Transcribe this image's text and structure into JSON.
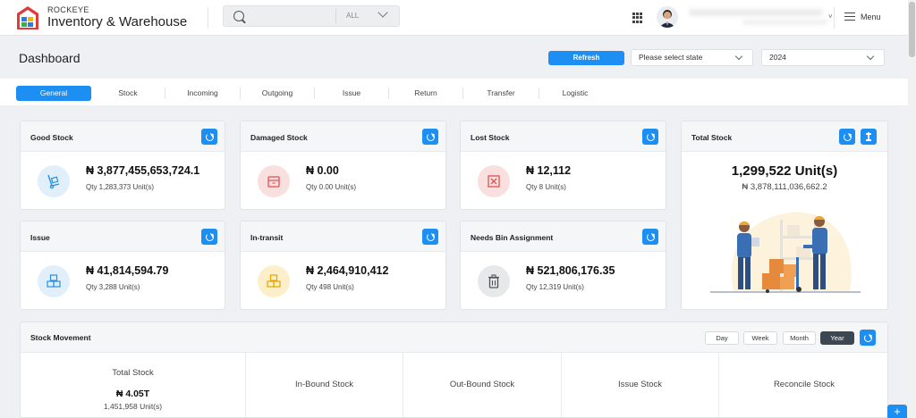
{
  "app": {
    "brand_small": "ROCKEYE",
    "brand_big": "Inventory & Warehouse",
    "menu_label": "Menu"
  },
  "search": {
    "placeholder": "",
    "scope": "ALL"
  },
  "dashboard": {
    "title": "Dashboard",
    "refresh_label": "Refresh",
    "state_select": "Please select state",
    "year_select": "2024"
  },
  "tabs": [
    {
      "label": "General"
    },
    {
      "label": "Stock"
    },
    {
      "label": "Incoming"
    },
    {
      "label": "Outgoing"
    },
    {
      "label": "Issue"
    },
    {
      "label": "Return"
    },
    {
      "label": "Transfer"
    },
    {
      "label": "Logistic"
    }
  ],
  "cards": {
    "good_stock": {
      "title": "Good Stock",
      "amount": "₦ 3,877,455,653,724.1",
      "qty": "Qty 1,283,373 Unit(s)",
      "icon": "hand-truck-icon",
      "color": "#e0eff9"
    },
    "damaged_stock": {
      "title": "Damaged Stock",
      "amount": "₦ 0.00",
      "qty": "Qty 0.00 Unit(s)",
      "icon": "box-icon",
      "color": "#f9dfdd"
    },
    "lost_stock": {
      "title": "Lost Stock",
      "amount": "₦ 12,112",
      "qty": "Qty 8 Unit(s)",
      "icon": "x-box-icon",
      "color": "#f9dfdd"
    },
    "issue": {
      "title": "Issue",
      "amount": "₦ 41,814,594.79",
      "qty": "Qty 3,288 Unit(s)",
      "icon": "boxes-icon",
      "color": "#e0eff9"
    },
    "in_transit": {
      "title": "In-transit",
      "amount": "₦ 2,464,910,412",
      "qty": "Qty 498 Unit(s)",
      "icon": "boxes-icon",
      "color": "#fcefc9"
    },
    "needs_bin": {
      "title": "Needs Bin Assignment",
      "amount": "₦ 521,806,176.35",
      "qty": "Qty 12,319 Unit(s)",
      "icon": "trash-icon",
      "color": "#e6e8ea"
    },
    "total_stock": {
      "title": "Total Stock",
      "units": "1,299,522 Unit(s)",
      "value": "₦ 3,878,111,036,662.2"
    }
  },
  "stock_movement": {
    "title": "Stock Movement",
    "periods": [
      "Day",
      "Week",
      "Month",
      "Year"
    ],
    "active_period": "Year",
    "total": {
      "label": "Total Stock",
      "amount": "₦ 4.05T",
      "qty": "1,451,958 Unit(s)"
    },
    "columns": [
      "In-Bound Stock",
      "Out-Bound Stock",
      "Issue Stock",
      "Reconcile Stock"
    ]
  },
  "colors": {
    "accent": "#1d8ef2",
    "dark_button": "#3d4752"
  }
}
